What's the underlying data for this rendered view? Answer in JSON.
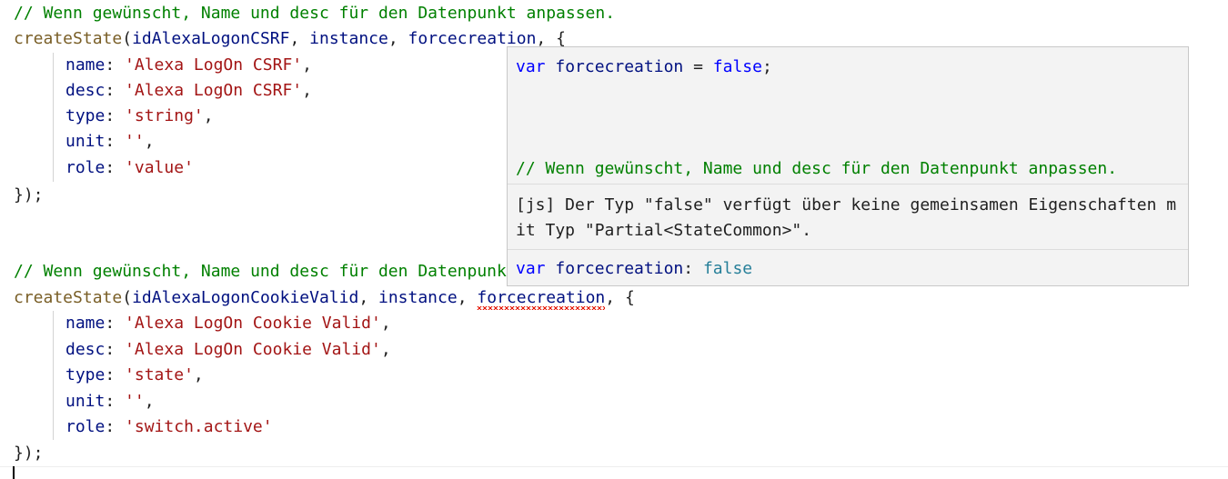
{
  "editor": {
    "block1": {
      "comment": "// Wenn gewünscht, Name und desc für den Datenpunkt anpassen.",
      "fn": "createState",
      "open_paren": "(",
      "arg1": "idAlexaLogonCSRF",
      "comma1": ", ",
      "arg2": "instance",
      "comma2": ", ",
      "arg3": "forcecreation",
      "tail": ", {",
      "props": [
        {
          "key": "name",
          "sep": ": ",
          "value": "'Alexa LogOn CSRF'",
          "end": ","
        },
        {
          "key": "desc",
          "sep": ": ",
          "value": "'Alexa LogOn CSRF'",
          "end": ","
        },
        {
          "key": "type",
          "sep": ": ",
          "value": "'string'",
          "end": ","
        },
        {
          "key": "unit",
          "sep": ": ",
          "value": "''",
          "end": ","
        },
        {
          "key": "role",
          "sep": ": ",
          "value": "'value'",
          "end": ""
        }
      ],
      "close": "});"
    },
    "block2": {
      "comment": "// Wenn gewünscht, Name und desc für den Datenpunkt anpassen.",
      "fn": "createState",
      "open_paren": "(",
      "arg1": "idAlexaLogonCookieValid",
      "comma1": ", ",
      "arg2": "instance",
      "comma2": ", ",
      "arg3": "forcecreation",
      "tail": ", {",
      "props": [
        {
          "key": "name",
          "sep": ": ",
          "value": "'Alexa LogOn Cookie Valid'",
          "end": ","
        },
        {
          "key": "desc",
          "sep": ": ",
          "value": "'Alexa LogOn Cookie Valid'",
          "end": ","
        },
        {
          "key": "type",
          "sep": ": ",
          "value": "'state'",
          "end": ","
        },
        {
          "key": "unit",
          "sep": ": ",
          "value": "''",
          "end": ","
        },
        {
          "key": "role",
          "sep": ": ",
          "value": "'switch.active'",
          "end": ""
        }
      ],
      "close": "});"
    }
  },
  "hover": {
    "decl_kw": "var",
    "decl_name": "forcecreation",
    "decl_eq": " = ",
    "decl_val": "false",
    "decl_end": ";",
    "doc_comment": "// Wenn gewünscht, Name und desc für den Datenpunkt anpassen.",
    "error_message": "[js] Der Typ \"false\" verfügt über keine gemeinsamen Eigenschaften mit Typ \"Partial<StateCommon>\".",
    "sig_kw": "var",
    "sig_name": "forcecreation",
    "sig_colon": ": ",
    "sig_type": "false"
  },
  "colors": {
    "comment": "#008000",
    "function": "#795e26",
    "variable": "#001080",
    "string": "#a31515",
    "keyword": "#0000ff",
    "type": "#267f99",
    "error_squiggle": "#e51400",
    "hover_background": "#f3f3f3"
  }
}
